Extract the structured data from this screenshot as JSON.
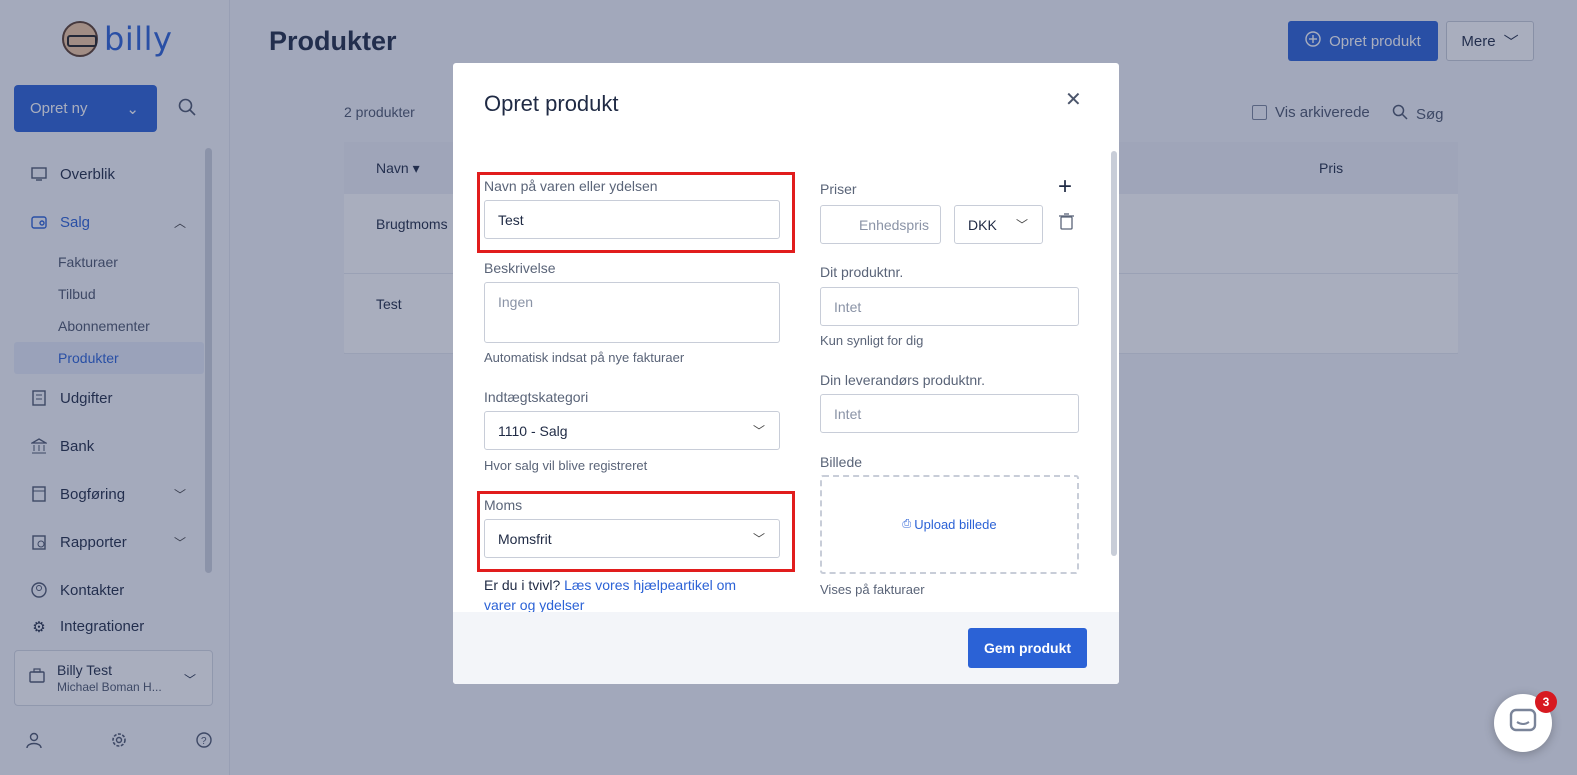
{
  "app": {
    "logo_text": "billy"
  },
  "sidebar": {
    "create_new_label": "Opret ny",
    "items": [
      {
        "label": "Overblik",
        "icon": "dashboard-icon"
      },
      {
        "label": "Salg",
        "icon": "sales-icon",
        "expanded": true
      },
      {
        "label": "Udgifter",
        "icon": "expenses-icon"
      },
      {
        "label": "Bank",
        "icon": "bank-icon"
      },
      {
        "label": "Bogføring",
        "icon": "ledger-icon"
      },
      {
        "label": "Rapporter",
        "icon": "reports-icon"
      },
      {
        "label": "Kontakter",
        "icon": "contacts-icon"
      },
      {
        "label": "Integrationer",
        "icon": "integrations-icon"
      }
    ],
    "sales_sub": [
      {
        "label": "Fakturaer"
      },
      {
        "label": "Tilbud"
      },
      {
        "label": "Abonnementer"
      },
      {
        "label": "Produkter",
        "active": true
      }
    ],
    "account": {
      "name": "Billy Test",
      "sub": "Michael Boman H..."
    }
  },
  "page": {
    "title": "Produkter",
    "create_button": "Opret produkt",
    "more_button": "Mere",
    "product_count": "2 produkter",
    "show_archived": "Vis arkiverede",
    "search": "Søg",
    "table": {
      "columns": [
        "Navn",
        "Pris"
      ],
      "rows": [
        {
          "name": "Brugtmoms"
        },
        {
          "name": "Test"
        }
      ]
    }
  },
  "modal": {
    "title": "Opret produkt",
    "name_label": "Navn på varen eller ydelsen",
    "name_value": "Test",
    "description_label": "Beskrivelse",
    "description_placeholder": "Ingen",
    "description_hint": "Automatisk indsat på nye fakturaer",
    "revenue_label": "Indtægtskategori",
    "revenue_value": "1110 - Salg",
    "revenue_hint": "Hvor salg vil blive registreret",
    "vat_label": "Moms",
    "vat_value": "Momsfrit",
    "help_prefix": "Er du i tvivl?",
    "help_link": "Læs vores hjælpeartikel om varer og ydelser",
    "prices_label": "Priser",
    "unit_price_placeholder": "Enhedspris",
    "currency_value": "DKK",
    "product_no_label": "Dit produktnr.",
    "product_no_placeholder": "Intet",
    "product_no_hint": "Kun synligt for dig",
    "supplier_no_label": "Din leverandørs produktnr.",
    "supplier_no_placeholder": "Intet",
    "image_label": "Billede",
    "upload_label": "Upload billede",
    "image_hint": "Vises på fakturaer",
    "save_button": "Gem produkt"
  },
  "chat": {
    "badge_count": "3"
  },
  "colors": {
    "accent": "#2b62d6",
    "highlight": "#e11d1d"
  }
}
